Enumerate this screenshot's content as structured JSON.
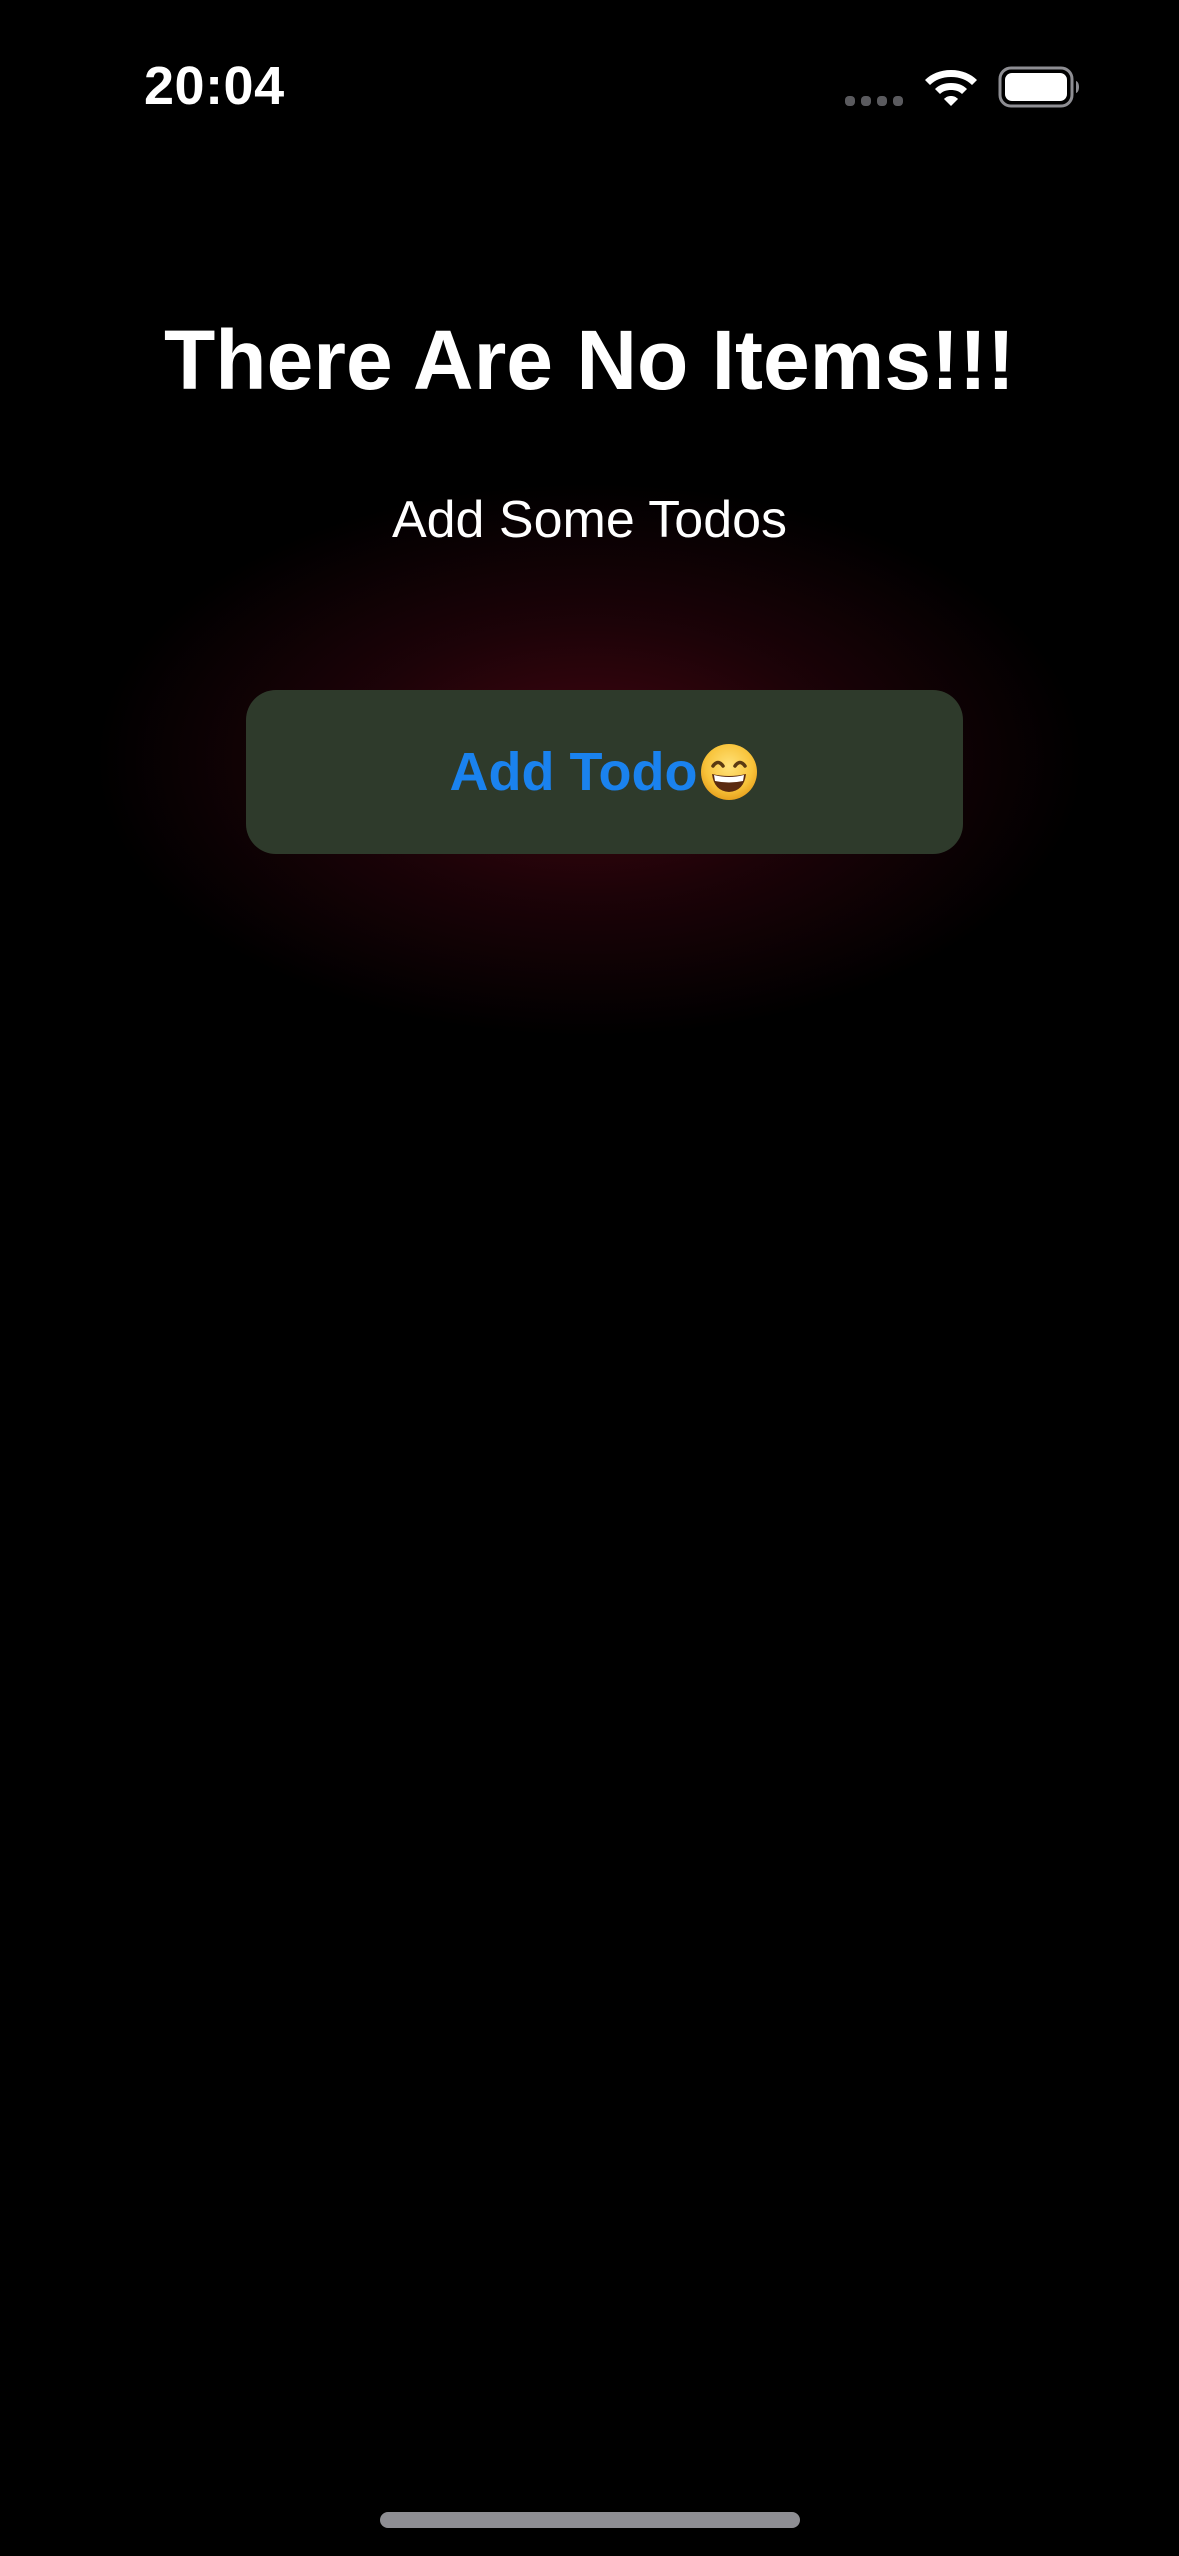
{
  "status_bar": {
    "time": "20:04",
    "icons": [
      "cellular-signal-icon",
      "wifi-icon",
      "battery-icon"
    ]
  },
  "main": {
    "title": "There Are No Items!!!",
    "subtitle": "Add Some Todos",
    "add_button": {
      "label": "Add Todo",
      "emoji_icon": "grinning-face-with-smiling-eyes-icon"
    }
  },
  "colors": {
    "background": "#000000",
    "text": "#ffffff",
    "button_background": "#2e3a2b",
    "button_text": "#1a82ee",
    "glow": "#780a1e"
  }
}
